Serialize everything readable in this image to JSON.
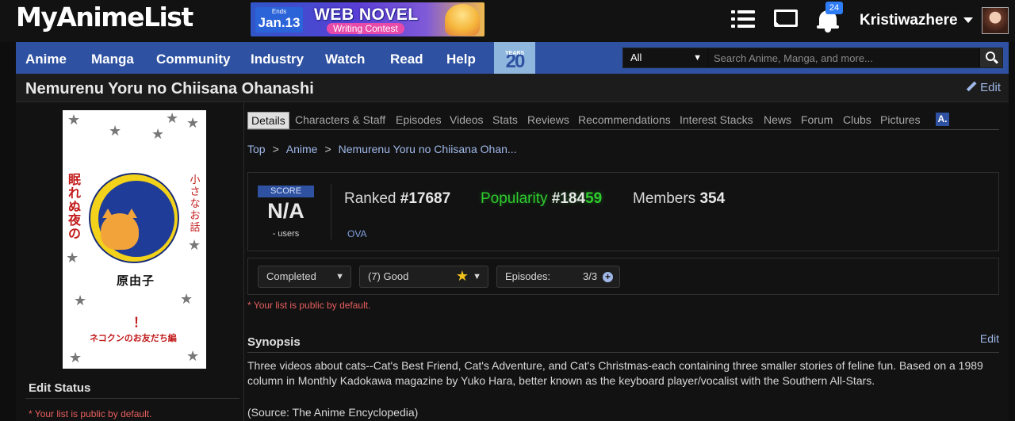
{
  "header": {
    "logo": "MyAnimeList",
    "banner": {
      "ends_label": "Ends",
      "ends_date": "Jan.13",
      "title": "WEB NOVEL",
      "subtitle": "Writing Contest"
    },
    "notification_count": "24",
    "username": "Kristiwazhere"
  },
  "nav": {
    "items": [
      "Anime",
      "Manga",
      "Community",
      "Industry",
      "Watch",
      "Read",
      "Help"
    ],
    "anniversary": {
      "years_label": "YEARS",
      "number": "20"
    },
    "search": {
      "category": "All",
      "placeholder": "Search Anime, Manga, and more..."
    }
  },
  "page": {
    "title": "Nemurenu Yoru no Chiisana Ohanashi",
    "edit_label": "Edit"
  },
  "cover": {
    "top_title": "眠れぬ夜の小さなお話",
    "left_text": "眠れぬ夜の",
    "right_text": "小さなお話",
    "author": "原由子",
    "mark": "！",
    "subtitle": "ネコクンのお友だち編"
  },
  "left": {
    "edit_status_heading": "Edit Status",
    "public_note": "* Your list is public by default."
  },
  "tabs": [
    "Details",
    "Characters & Staff",
    "Episodes",
    "Videos",
    "Stats",
    "Reviews",
    "Recommendations",
    "Interest Stacks",
    "News",
    "Forum",
    "Clubs",
    "Pictures"
  ],
  "tab_extra_label": "A.",
  "breadcrumb": [
    "Top",
    "Anime",
    "Nemurenu Yoru no Chiisana Ohan..."
  ],
  "stats": {
    "score_label": "SCORE",
    "score_value": "N/A",
    "score_users": "- users",
    "ranked_label": "Ranked",
    "ranked_value": "#17687",
    "popularity_label": "Popularity",
    "popularity_value_a": "#184",
    "popularity_value_b": "59",
    "members_label": "Members",
    "members_value": "354",
    "type": "OVA"
  },
  "list": {
    "status": "Completed",
    "score": "(7) Good",
    "episodes_label": "Episodes:",
    "episodes_value": "3/3",
    "public_note": "* Your list is public by default."
  },
  "synopsis": {
    "heading": "Synopsis",
    "edit_label": "Edit",
    "text": "Three videos about cats--Cat's Best Friend, Cat's Adventure, and Cat's Christmas-each containing three smaller stories of feline fun. Based on a 1989 column in Monthly Kadokawa magazine by Yuko Hara, better known as the keyboard player/vocalist with the Southern All-Stars.",
    "source": "(Source: The Anime Encyclopedia)"
  },
  "colors": {
    "nav_blue": "#2e51a2",
    "link_blue": "#9fb8e8",
    "popularity_green": "#2ecc2e",
    "note_red": "#e75e5e"
  },
  "icons": [
    "list-icon",
    "mail-icon",
    "bell-icon",
    "search-icon",
    "pencil-icon",
    "star-icon",
    "plus-icon",
    "chevron-down-icon"
  ]
}
